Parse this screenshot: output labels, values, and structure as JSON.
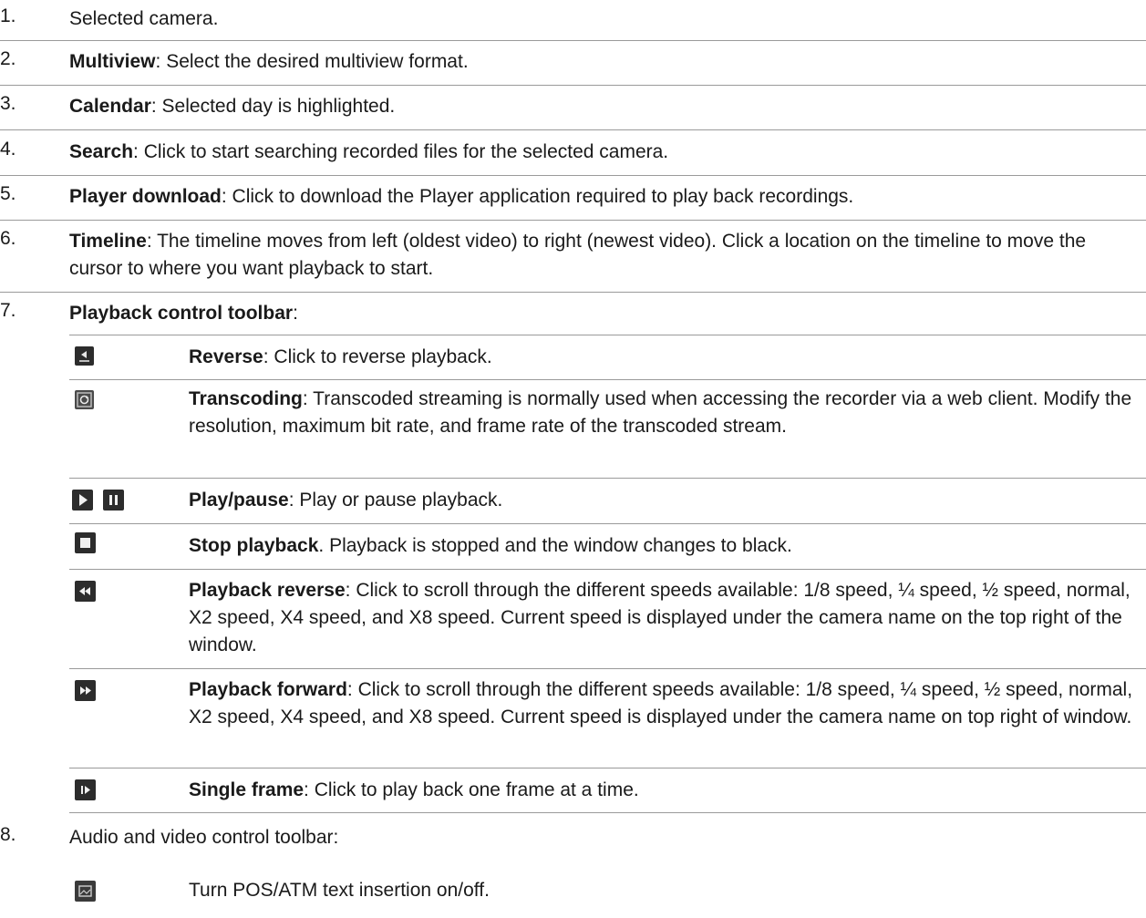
{
  "items": [
    {
      "num": "1.",
      "title": "",
      "sep": "",
      "text": "Selected camera."
    },
    {
      "num": "2.",
      "title": "Multiview",
      "sep": ": ",
      "text": "Select the desired multiview format."
    },
    {
      "num": "3.",
      "title": "Calendar",
      "sep": ": ",
      "text": "Selected day is highlighted."
    },
    {
      "num": "4.",
      "title": "Search",
      "sep": ": ",
      "text": "Click to start searching recorded files for the selected camera."
    },
    {
      "num": "5.",
      "title": "Player download",
      "sep": ": ",
      "text": "Click to download the Player application required to play back recordings."
    },
    {
      "num": "6.",
      "title": "Timeline",
      "sep": ": ",
      "text": "The timeline moves from left (oldest video) to right (newest video). Click a location on the timeline to move the cursor to where you want playback to start."
    },
    {
      "num": "7.",
      "title": "Playback control toolbar",
      "sep": ":",
      "text": ""
    },
    {
      "num": "8.",
      "title": "",
      "sep": "",
      "text": "Audio and video control toolbar:"
    }
  ],
  "controls": [
    {
      "icon": "reverse-icon",
      "title": "Reverse",
      "sep": ": ",
      "text": "Click to reverse playback."
    },
    {
      "icon": "transcoding-icon",
      "title": "Transcoding",
      "sep": ": ",
      "text": "Transcoded streaming is normally used when accessing the recorder via a web client. Modify the resolution, maximum bit rate, and frame rate of the transcoded stream."
    },
    {
      "icon": "play-pause-icon",
      "title": "Play/pause",
      "sep": ": ",
      "text": "Play or pause playback."
    },
    {
      "icon": "stop-icon",
      "title": "Stop playback",
      "sep": ". ",
      "text": "Playback is stopped and the window changes to black."
    },
    {
      "icon": "rewind-icon",
      "title": "Playback reverse",
      "sep": ": ",
      "text": "Click to scroll through the different speeds available: 1/8 speed, ¼ speed, ½ speed, normal, X2 speed, X4 speed, and X8 speed. Current speed is displayed under the camera name on the top right of the window."
    },
    {
      "icon": "fast-forward-icon",
      "title": "Playback forward",
      "sep": ": ",
      "text": "Click to scroll through the different speeds available: 1/8 speed, ¼ speed, ½ speed, normal, X2 speed, X4 speed, and X8 speed. Current speed is displayed under the camera name on top right of window."
    },
    {
      "icon": "single-frame-icon",
      "title": "Single frame",
      "sep": ": ",
      "text": "Click to play back one frame at a time."
    }
  ],
  "audio_video": [
    {
      "icon": "pos-atm-icon",
      "text": "Turn POS/ATM text insertion on/off."
    }
  ]
}
